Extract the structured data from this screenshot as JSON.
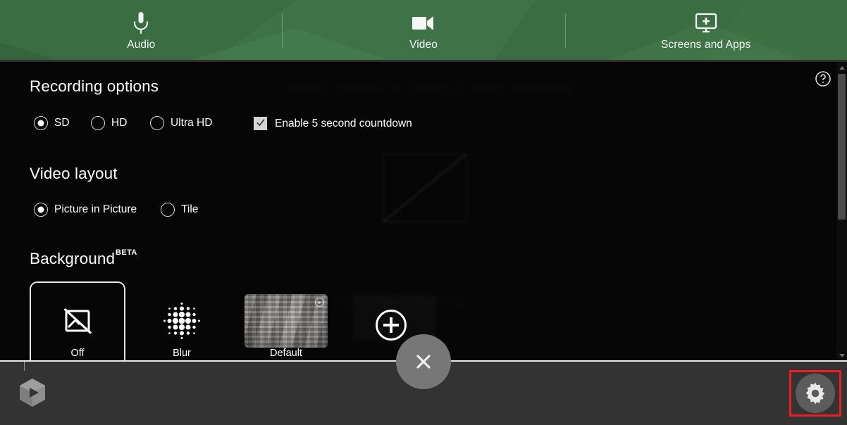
{
  "tabs": [
    {
      "label": "Audio",
      "icon": "microphone-icon"
    },
    {
      "label": "Video",
      "icon": "video-camera-icon"
    },
    {
      "label": "Screens and Apps",
      "icon": "monitor-plus-icon"
    }
  ],
  "panel": {
    "recording": {
      "title": "Recording options",
      "quality_options": [
        {
          "label": "SD",
          "selected": true
        },
        {
          "label": "HD",
          "selected": false
        },
        {
          "label": "Ultra HD",
          "selected": false
        }
      ],
      "countdown": {
        "label": "Enable 5 second countdown",
        "checked": true
      }
    },
    "layout": {
      "title": "Video layout",
      "options": [
        {
          "label": "Picture in Picture",
          "selected": true
        },
        {
          "label": "Tile",
          "selected": false
        }
      ]
    },
    "background": {
      "title": "Background",
      "badge": "BETA",
      "items": [
        {
          "label": "Off",
          "selected": true,
          "icon": "no-image-icon"
        },
        {
          "label": "Blur",
          "selected": false,
          "icon": "blur-dots-icon"
        },
        {
          "label": "Default",
          "selected": false,
          "icon": "image-thumbnail"
        }
      ],
      "add_label": "+"
    },
    "help_icon": "question-mark-circle-icon",
    "ghost_text_top": "Select camera to create a video recording",
    "ghost_text_mid": "Start video recording"
  },
  "bottom_bar": {
    "logo": "stream-play-logo",
    "settings_icon": "gear-icon",
    "close_icon": "close-x-icon"
  },
  "colors": {
    "header_green": "#3a6b41",
    "panel_black": "#060606",
    "bottom_gray": "#333333",
    "highlight_red": "#ee1c25",
    "gear_circle": "#5c5c5c",
    "close_circle": "#777777"
  }
}
